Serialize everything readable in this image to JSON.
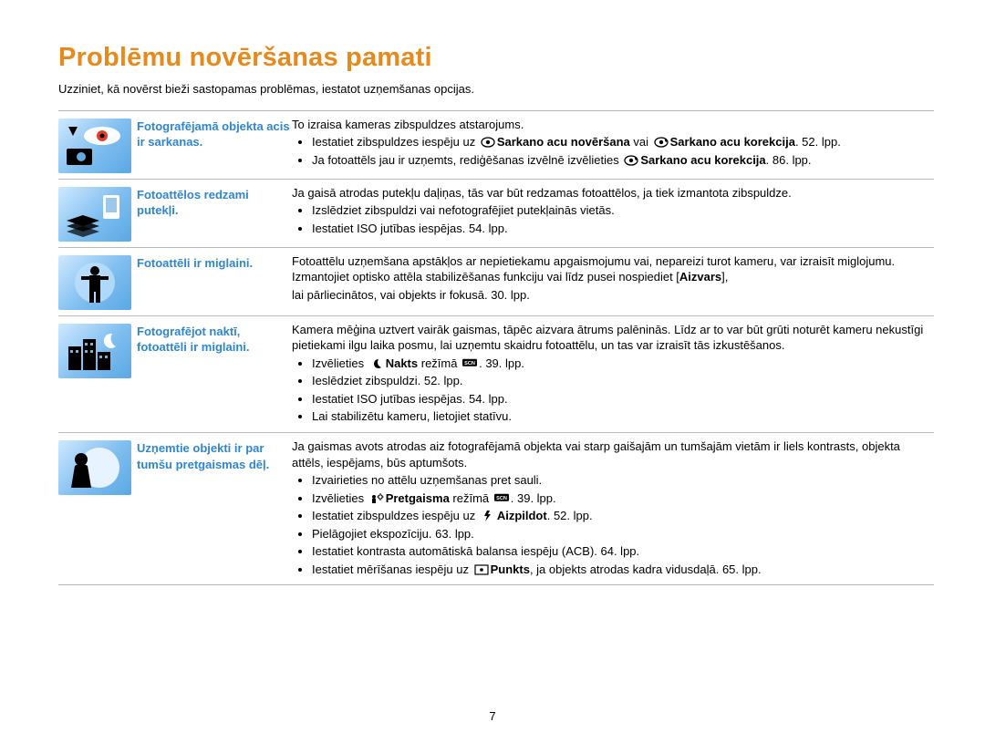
{
  "page_number": "7",
  "title": "Problēmu novēršanas pamati",
  "subtitle": "Uzziniet, kā novērst bieži sastopamas problēmas, iestatot uzņemšanas opcijas.",
  "rows": [
    {
      "label": "Fotografējamā objekta acis ir sarkanas.",
      "intro": "To izraisa kameras zibspuldzes atstarojums.",
      "bullets": [
        {
          "pre": "Iestatiet zibspuldzes iespēju uz ",
          "icon": "eye",
          "bold": "Sarkano acu novēršana",
          "mid": " vai ",
          "icon2": "eye-fix",
          "bold2": "Sarkano acu korekcija",
          "post": ". 52. lpp."
        },
        {
          "pre": "Ja fotoattēls jau ir uzņemts, rediģēšanas izvēlnē izvēlieties ",
          "icon": "eye-fix",
          "bold": "Sarkano acu korekcija",
          "post": ". 86. lpp."
        }
      ]
    },
    {
      "label": "Fotoattēlos redzami putekļi.",
      "intro": "Ja gaisā atrodas putekļu daļiņas, tās var būt redzamas fotoattēlos, ja tiek izmantota zibspuldze.",
      "bullets": [
        {
          "pre": "Izslēdziet zibspuldzi vai nefotografējiet putekļainās vietās."
        },
        {
          "pre": "Iestatiet ISO jutības iespējas. 54. lpp."
        }
      ]
    },
    {
      "label": "Fotoattēli ir miglaini.",
      "intro_parts": [
        "Fotoattēlu uzņemšana apstākļos ar nepietiekamu apgaismojumu vai, nepareizi turot kameru, var izraisīt miglojumu. Izmantojiet optisko attēla stabilizēšanas funkciju vai līdz pusei nospiediet [",
        "Aizvars",
        "],"
      ],
      "intro_tail": "lai pārliecinātos, vai objekts ir fokusā. 30. lpp."
    },
    {
      "label": "Fotografējot naktī, fotoattēli ir miglaini.",
      "intro": "Kamera mēģina uztvert vairāk gaismas, tāpēc aizvara ātrums palēninās. Līdz ar to var būt grūti noturēt kameru nekustīgi pietiekami ilgu laika posmu, lai uzņemtu skaidru fotoattēlu, un tas var izraisīt tās izkustēšanos.",
      "bullets": [
        {
          "pre": "Izvēlieties ",
          "icon": "moon",
          "bold": "Nakts",
          "mid": " režīmā ",
          "icon2": "scn",
          "post": ". 39. lpp."
        },
        {
          "pre": "Ieslēdziet zibspuldzi. 52. lpp."
        },
        {
          "pre": "Iestatiet ISO jutības iespējas. 54. lpp."
        },
        {
          "pre": "Lai stabilizētu kameru, lietojiet statīvu."
        }
      ]
    },
    {
      "label": "Uzņemtie objekti ir par tumšu pretgaismas dēļ.",
      "intro": "Ja gaismas avots atrodas aiz fotografējamā objekta vai starp gaišajām un tumšajām vietām ir liels kontrasts, objekta attēls, iespējams, būs aptumšots.",
      "bullets": [
        {
          "pre": "Izvairieties no attēlu uzņemšanas pret sauli."
        },
        {
          "pre": "Izvēlieties ",
          "icon": "sun-person",
          "bold": "Pretgaisma",
          "mid": " režīmā ",
          "icon2": "scn",
          "post": ". 39. lpp."
        },
        {
          "pre": "Iestatiet zibspuldzes iespēju uz ",
          "icon": "flash",
          "bold": "Aizpildot",
          "post": ". 52. lpp."
        },
        {
          "pre": "Pielāgojiet ekspozīciju. 63. lpp."
        },
        {
          "pre": "Iestatiet kontrasta automātiskā balansa iespēju (ACB). 64. lpp."
        },
        {
          "pre": "Iestatiet mērīšanas iespēju uz ",
          "icon": "spot",
          "bold": "Punkts",
          "post": ", ja objekts atrodas kadra vidusdaļā. 65. lpp."
        }
      ]
    }
  ]
}
